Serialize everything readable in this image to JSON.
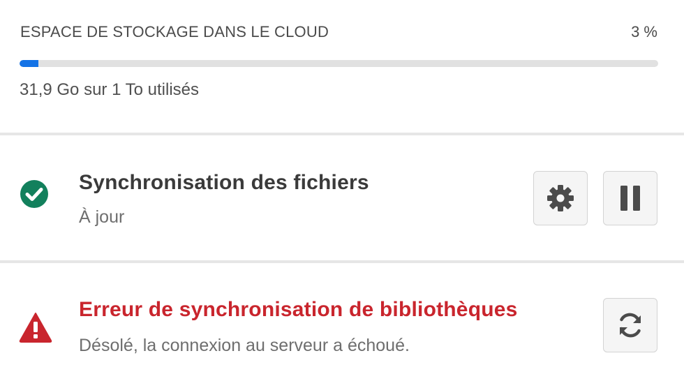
{
  "storage": {
    "title": "ESPACE DE STOCKAGE DANS LE CLOUD",
    "percent_label": "3 %",
    "percent_value": 3,
    "usage": "31,9 Go sur 1 To utilisés",
    "bar_color": "#1473e6"
  },
  "file_sync": {
    "title": "Synchronisation des fichiers",
    "status": "À jour",
    "status_icon": "check-circle-icon",
    "status_color": "#12805c",
    "settings_icon": "gear-icon",
    "pause_icon": "pause-icon"
  },
  "library_sync": {
    "title": "Erreur de synchronisation de bibliothèques",
    "message": "Désolé, la connexion au serveur a échoué.",
    "status_icon": "alert-triangle-icon",
    "status_color": "#c9252d",
    "retry_icon": "refresh-icon"
  }
}
